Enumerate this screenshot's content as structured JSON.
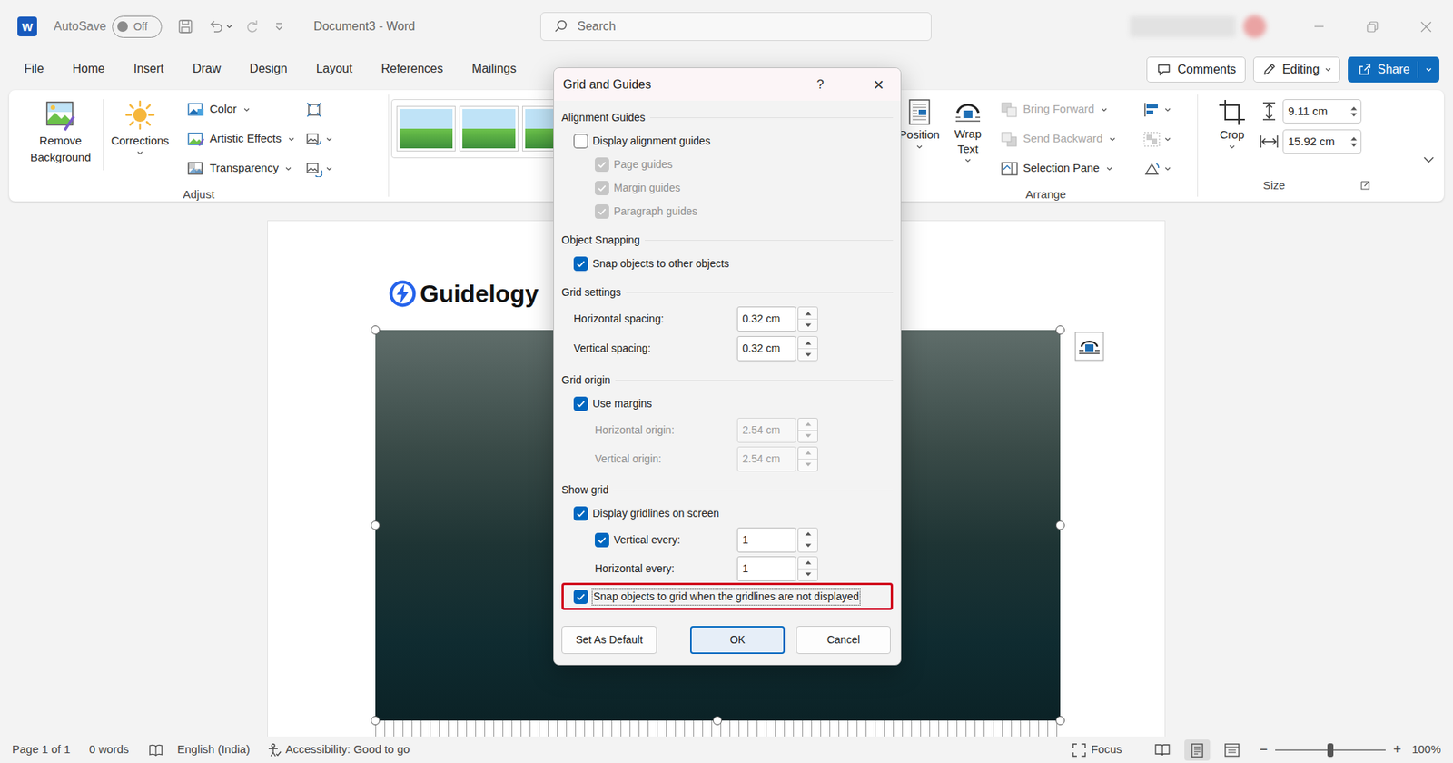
{
  "window": {
    "app_letter": "W",
    "autosave": {
      "label": "AutoSave",
      "state": "Off",
      "on": false
    },
    "title": "Document3 - Word",
    "search_placeholder": "Search"
  },
  "menu": {
    "tabs": [
      {
        "label": "File",
        "selected": false
      },
      {
        "label": "Home",
        "selected": false
      },
      {
        "label": "Insert",
        "selected": false
      },
      {
        "label": "Draw",
        "selected": false
      },
      {
        "label": "Design",
        "selected": false
      },
      {
        "label": "Layout",
        "selected": false
      },
      {
        "label": "References",
        "selected": false
      },
      {
        "label": "Mailings",
        "selected": false
      }
    ],
    "comments": "Comments",
    "editing": "Editing",
    "share": "Share"
  },
  "ribbon": {
    "adjust": {
      "label": "Adjust",
      "remove_background": "Remove Background",
      "corrections": "Corrections",
      "items": [
        {
          "label": "Color",
          "kind": "color"
        },
        {
          "label": "Artistic Effects",
          "kind": "effects"
        },
        {
          "label": "Transparency",
          "kind": "transparency"
        }
      ]
    },
    "arrange": {
      "label": "Arrange",
      "position": "Position",
      "wrap_text": "Wrap Text",
      "items": [
        {
          "label": "Bring Forward",
          "kind": "forward",
          "disabled": true
        },
        {
          "label": "Send Backward",
          "kind": "backward",
          "disabled": true
        },
        {
          "label": "Selection Pane",
          "kind": "pane",
          "disabled": false
        }
      ]
    },
    "size": {
      "label": "Size",
      "crop": "Crop",
      "height": "9.11 cm",
      "width": "15.92 cm"
    }
  },
  "document": {
    "logo": "Guidelogy",
    "picture": {
      "selected": true
    }
  },
  "dialog": {
    "title": "Grid and Guides",
    "help": "?",
    "close": "×",
    "sections": [
      {
        "heading": "Alignment Guides",
        "rows": [
          {
            "kind": "checkbox",
            "label": "Display alignment guides",
            "checked": false,
            "disabled": false,
            "highlighted": false,
            "children": [
              {
                "kind": "checkbox",
                "label": "Page guides",
                "checked": true,
                "disabled": true,
                "highlighted": false
              },
              {
                "kind": "checkbox",
                "label": "Margin guides",
                "checked": true,
                "disabled": true,
                "highlighted": false
              },
              {
                "kind": "checkbox",
                "label": "Paragraph guides",
                "checked": true,
                "disabled": true,
                "highlighted": false
              }
            ]
          }
        ]
      },
      {
        "heading": "Object Snapping",
        "rows": [
          {
            "kind": "checkbox",
            "label": "Snap objects to other objects",
            "checked": true,
            "disabled": false,
            "highlighted": false
          }
        ]
      },
      {
        "heading": "Grid settings",
        "rows": [
          {
            "kind": "spin",
            "label": "Horizontal spacing:",
            "value": "0.32 cm",
            "disabled": false,
            "highlighted": false
          },
          {
            "kind": "spin",
            "label": "Vertical spacing:",
            "value": "0.32 cm",
            "disabled": false,
            "highlighted": false
          }
        ]
      },
      {
        "heading": "Grid origin",
        "rows": [
          {
            "kind": "checkbox",
            "label": "Use margins",
            "checked": true,
            "disabled": false,
            "highlighted": false,
            "children": [
              {
                "kind": "spin",
                "label": "Horizontal origin:",
                "value": "2.54 cm",
                "disabled": true,
                "highlighted": false
              },
              {
                "kind": "spin",
                "label": "Vertical origin:",
                "value": "2.54 cm",
                "disabled": true,
                "highlighted": false
              }
            ]
          }
        ]
      },
      {
        "heading": "Show grid",
        "rows": [
          {
            "kind": "checkbox",
            "label": "Display gridlines on screen",
            "checked": true,
            "disabled": false,
            "highlighted": false,
            "children": [
              {
                "kind": "checkspin",
                "label": "Vertical every:",
                "checked": true,
                "value": "1",
                "disabled": false,
                "highlighted": false
              },
              {
                "kind": "spin",
                "label": "Horizontal every:",
                "value": "1",
                "disabled": false,
                "highlighted": false
              }
            ]
          },
          {
            "kind": "checkbox",
            "label": "Snap objects to grid when the gridlines are not displayed",
            "checked": true,
            "disabled": false,
            "highlighted": true
          }
        ]
      }
    ],
    "buttons": [
      {
        "label": "Set As Default",
        "default": false
      },
      {
        "label": "OK",
        "default": true
      },
      {
        "label": "Cancel",
        "default": false
      }
    ]
  },
  "status_bar": {
    "page": "Page 1 of 1",
    "words": "0 words",
    "language": "English (India)",
    "accessibility": "Accessibility: Good to go",
    "focus": "Focus",
    "views": [
      {
        "kind": "read",
        "selected": false
      },
      {
        "kind": "print",
        "selected": true
      },
      {
        "kind": "web",
        "selected": false
      }
    ],
    "zoom_out": "−",
    "zoom_in": "+",
    "zoom_level": 0.5,
    "zoom": "100%"
  }
}
